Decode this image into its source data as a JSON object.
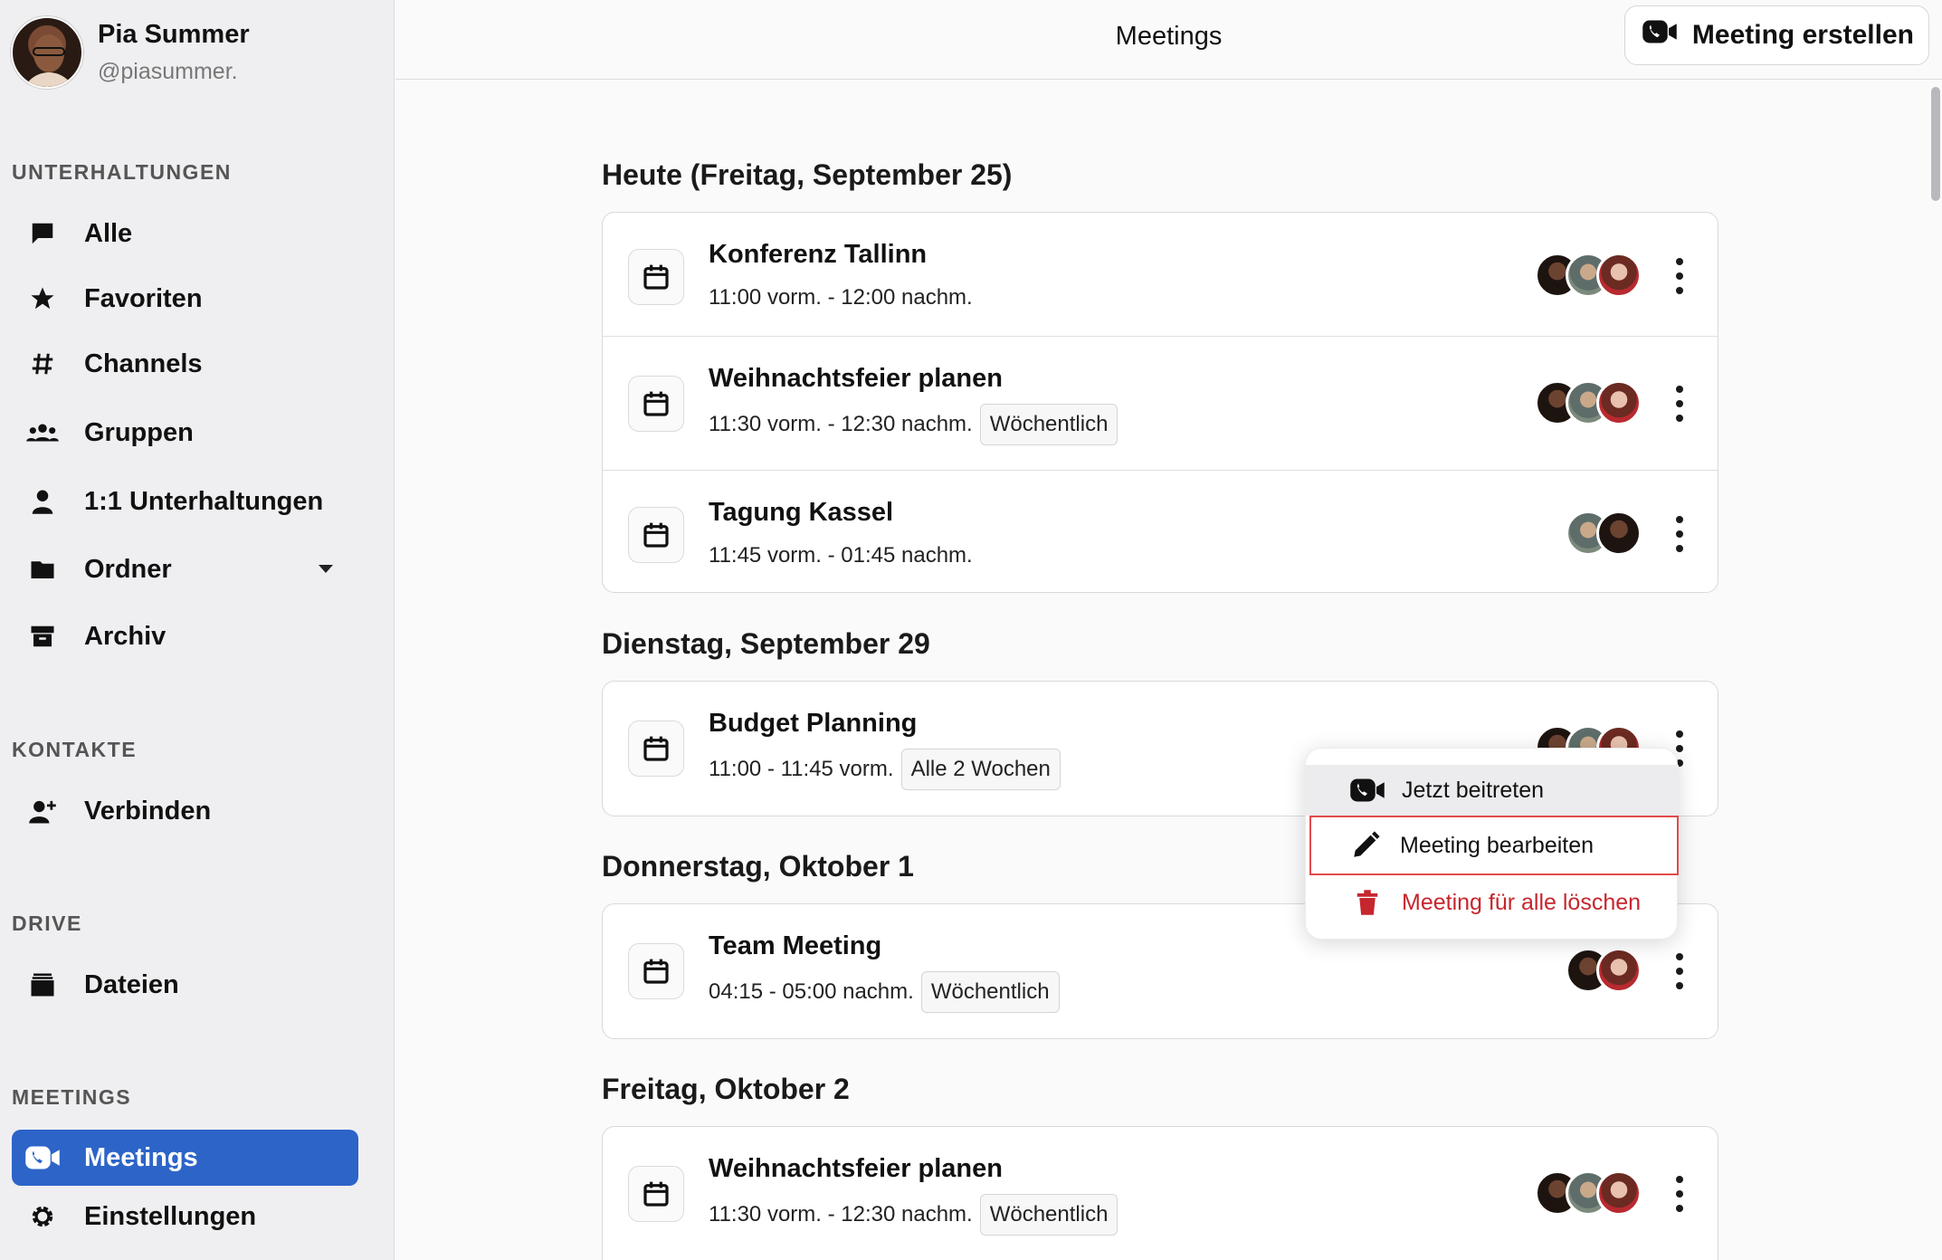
{
  "user": {
    "name": "Pia Summer",
    "handle": "@piasummer."
  },
  "sidebar": {
    "sections": {
      "conversations": "UNTERHALTUNGEN",
      "contacts": "KONTAKTE",
      "drive": "DRIVE",
      "meetings": "MEETINGS"
    },
    "items": {
      "all": "Alle",
      "favorites": "Favoriten",
      "channels": "Channels",
      "groups": "Gruppen",
      "direct": "1:1 Unterhaltungen",
      "folders": "Ordner",
      "archive": "Archiv",
      "connect": "Verbinden",
      "files": "Dateien",
      "meetings": "Meetings",
      "settings": "Einstellungen"
    },
    "active_color": "#2d64c8"
  },
  "header": {
    "title": "Meetings",
    "create_label": "Meeting erstellen"
  },
  "days": [
    {
      "title": "Heute (Freitag, September 25)",
      "meetings": [
        {
          "title": "Konferenz Tallinn",
          "time": "11:00 vorm. - 12:00 nachm.",
          "badge": ""
        },
        {
          "title": "Weihnachtsfeier planen",
          "time": "11:30 vorm. - 12:30 nachm.",
          "badge": "Wöchentlich"
        },
        {
          "title": "Tagung Kassel",
          "time": "11:45 vorm. - 01:45 nachm.",
          "badge": ""
        }
      ]
    },
    {
      "title": "Dienstag, September 29",
      "meetings": [
        {
          "title": "Budget Planning",
          "time": "11:00 - 11:45 vorm.",
          "badge": "Alle 2 Wochen"
        }
      ]
    },
    {
      "title": "Donnerstag, Oktober 1",
      "meetings": [
        {
          "title": "Team Meeting",
          "time": "04:15 - 05:00 nachm.",
          "badge": "Wöchentlich"
        }
      ]
    },
    {
      "title": "Freitag, Oktober 2",
      "meetings": [
        {
          "title": "Weihnachtsfeier planen",
          "time": "11:30 vorm. - 12:30 nachm.",
          "badge": "Wöchentlich"
        }
      ]
    }
  ],
  "menu": {
    "join": "Jetzt beitreten",
    "edit": "Meeting bearbeiten",
    "delete": "Meeting für alle löschen",
    "delete_color": "#c6262e",
    "highlight_color": "#e24b4b"
  }
}
